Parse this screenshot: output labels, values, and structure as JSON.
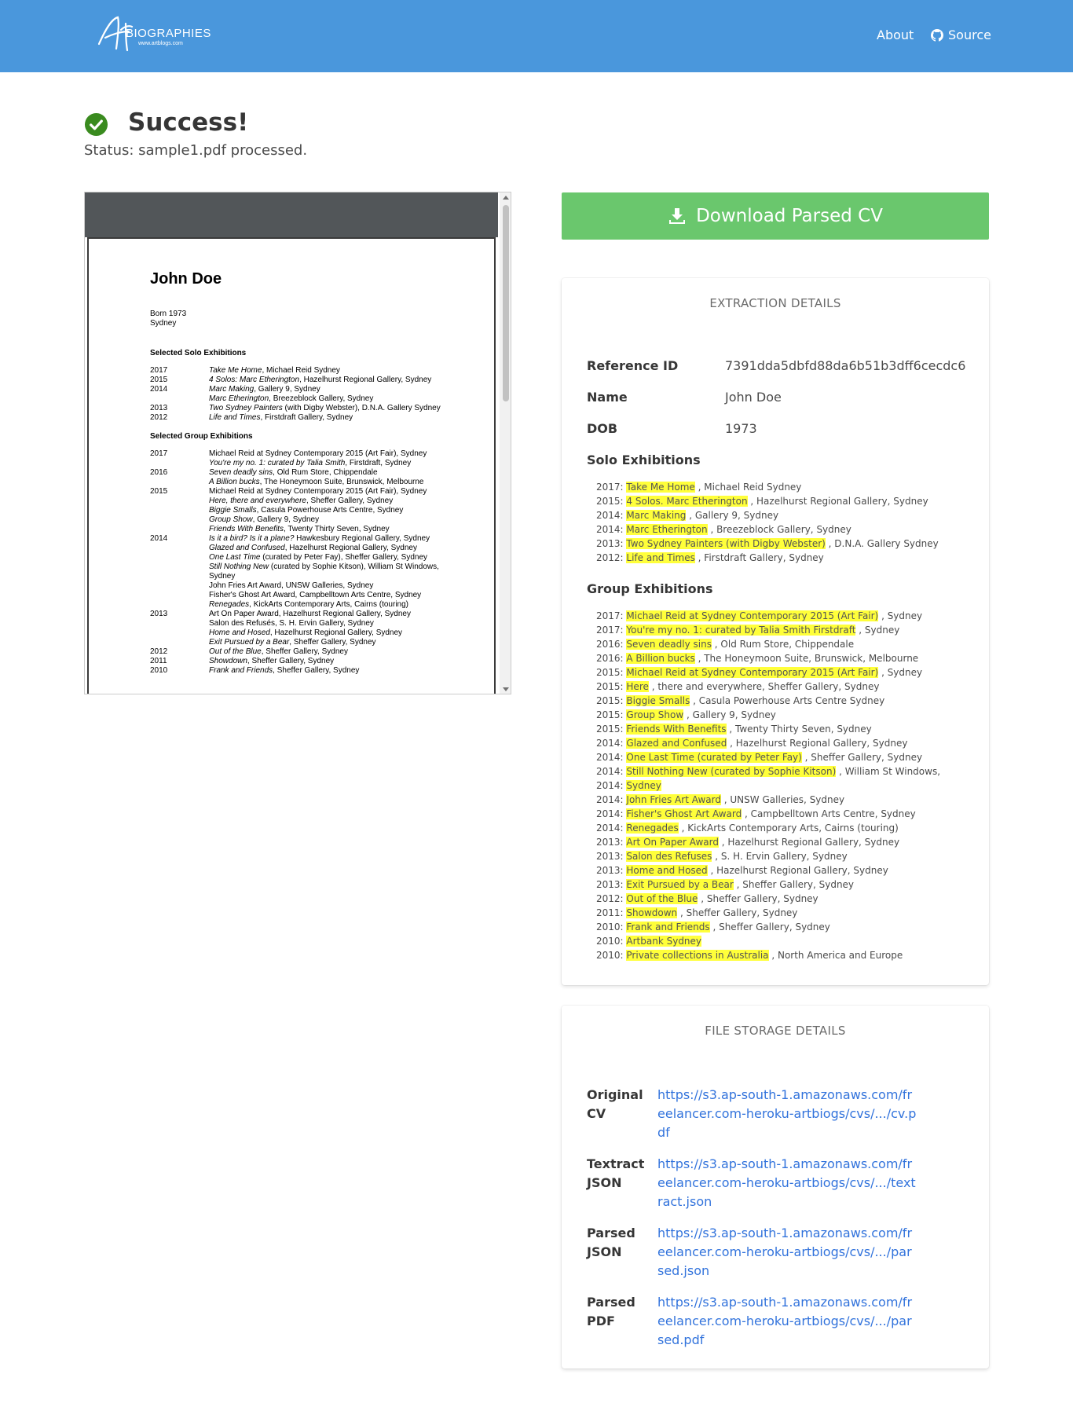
{
  "nav": {
    "logo_text": "BIOGRAPHIES",
    "logo_url": "www.artblogs.com",
    "about": "About",
    "source": "Source",
    "colors": {
      "navbar": "#4a97dc"
    }
  },
  "status": {
    "title": "Success!",
    "message": "Status: sample1.pdf processed.",
    "icon": "check-circle-icon",
    "color": "#3a8b1f"
  },
  "pdf": {
    "name": "John Doe",
    "born": [
      "Born 1973",
      "Sydney"
    ],
    "solo_heading": "Selected Solo Exhibitions",
    "solo": [
      {
        "year": "2017",
        "title": "Take Me Home",
        "rest": ", Michael Reid Sydney"
      },
      {
        "year": "2015",
        "title": "4 Solos: Marc Etherington",
        "rest": ", Hazelhurst Regional Gallery, Sydney"
      },
      {
        "year": "2014",
        "title": "Marc Making",
        "rest": ", Gallery 9, Sydney"
      },
      {
        "year": "",
        "title": "Marc Etherington",
        "rest": ", Breezeblock Gallery, Sydney"
      },
      {
        "year": "2013",
        "title": "Two Sydney Painters",
        "rest": " (with Digby Webster), D.N.A. Gallery Sydney"
      },
      {
        "year": "2012",
        "title": "Life and Times",
        "rest": ", Firstdraft Gallery, Sydney"
      }
    ],
    "group_heading": "Selected Group Exhibitions",
    "group": [
      {
        "year": "2017",
        "title": "",
        "rest": "Michael Reid at Sydney Contemporary 2015 (Art Fair), Sydney"
      },
      {
        "year": "",
        "title": "You're my no. 1: curated by Talia Smith",
        "rest": ", Firstdraft, Sydney"
      },
      {
        "year": "2016",
        "title": "Seven deadly sins",
        "rest": ", Old Rum Store, Chippendale"
      },
      {
        "year": "",
        "title": "A Billion bucks",
        "rest": ", The Honeymoon Suite, Brunswick, Melbourne"
      },
      {
        "year": "2015",
        "title": "",
        "rest": "Michael Reid at Sydney Contemporary 2015 (Art Fair), Sydney"
      },
      {
        "year": "",
        "title": "Here, there and everywhere",
        "rest": ", Sheffer Gallery, Sydney"
      },
      {
        "year": "",
        "title": "Biggie Smalls",
        "rest": ", Casula Powerhouse Arts Centre, Sydney"
      },
      {
        "year": "",
        "title": "Group Show",
        "rest": ", Gallery 9, Sydney"
      },
      {
        "year": "",
        "title": "Friends With Benefits",
        "rest": ", Twenty Thirty Seven, Sydney"
      },
      {
        "year": "2014",
        "title": "Is it a bird? Is it a plane?",
        "rest": " Hawkesbury Regional Gallery, Sydney"
      },
      {
        "year": "",
        "title": "Glazed and Confused",
        "rest": ", Hazelhurst Regional Gallery, Sydney"
      },
      {
        "year": "",
        "title": "One Last Time",
        "rest": " (curated by Peter Fay), Sheffer Gallery, Sydney"
      },
      {
        "year": "",
        "title": "Still Nothing New",
        "rest": " (curated by Sophie Kitson), William St Windows,"
      },
      {
        "year": "",
        "title": "",
        "rest": "Sydney"
      },
      {
        "year": "",
        "title": "",
        "rest": "John Fries Art Award, UNSW Galleries, Sydney"
      },
      {
        "year": "",
        "title": "",
        "rest": "Fisher's Ghost Art Award, Campbelltown Arts Centre, Sydney"
      },
      {
        "year": "",
        "title": "Renegades",
        "rest": ", KickArts Contemporary Arts, Cairns (touring)"
      },
      {
        "year": "2013",
        "title": "",
        "rest": "Art On Paper Award, Hazelhurst Regional Gallery, Sydney"
      },
      {
        "year": "",
        "title": "",
        "rest": "Salon des Refusés, S. H. Ervin Gallery, Sydney"
      },
      {
        "year": "",
        "title": "Home and Hosed",
        "rest": ", Hazelhurst Regional Gallery, Sydney"
      },
      {
        "year": "",
        "title": "Exit Pursued by a Bear",
        "rest": ", Sheffer Gallery, Sydney"
      },
      {
        "year": "2012",
        "title": "Out of the Blue",
        "rest": ", Sheffer Gallery, Sydney"
      },
      {
        "year": "2011",
        "title": "Showdown",
        "rest": ", Sheffer Gallery, Sydney"
      },
      {
        "year": "2010",
        "title": "Frank and Friends",
        "rest": ", Sheffer Gallery, Sydney"
      }
    ]
  },
  "download": {
    "label": "Download Parsed CV",
    "color": "#6ac76d"
  },
  "extraction": {
    "header": "EXTRACTION DETAILS",
    "reference_label": "Reference ID",
    "reference_value": "7391dda5dbfd88da6b51b3dff6cecdc6",
    "name_label": "Name",
    "name_value": "John Doe",
    "dob_label": "DOB",
    "dob_value": "1973",
    "solo_title": "Solo Exhibitions",
    "solo": [
      {
        "year": "2017:",
        "hl": "Take Me Home",
        "rest": " , Michael Reid Sydney"
      },
      {
        "year": "2015:",
        "hl": "4 Solos. Marc Etherington",
        "rest": " , Hazelhurst Regional Gallery, Sydney"
      },
      {
        "year": "2014:",
        "hl": "Marc Making",
        "rest": " , Gallery 9, Sydney"
      },
      {
        "year": "2014:",
        "hl": "Marc Etherington",
        "rest": " , Breezeblock Gallery, Sydney"
      },
      {
        "year": "2013:",
        "hl": "Two Sydney Painters (with Digby Webster)",
        "rest": " , D.N.A. Gallery Sydney"
      },
      {
        "year": "2012:",
        "hl": "Life and Times",
        "rest": " , Firstdraft Gallery, Sydney"
      }
    ],
    "group_title": "Group Exhibitions",
    "group": [
      {
        "year": "2017:",
        "hl": "Michael Reid at Sydney Contemporary 2015 (Art Fair)",
        "rest": " , Sydney"
      },
      {
        "year": "2017:",
        "hl": "You're my no. 1: curated by Talia Smith Firstdraft",
        "rest": " , Sydney"
      },
      {
        "year": "2016:",
        "hl": "Seven deadly sins",
        "rest": " , Old Rum Store, Chippendale"
      },
      {
        "year": "2016:",
        "hl": "A Billion bucks",
        "rest": " , The Honeymoon Suite, Brunswick, Melbourne"
      },
      {
        "year": "2015:",
        "hl": "Michael Reid at Sydney Contemporary 2015 (Art Fair)",
        "rest": " , Sydney"
      },
      {
        "year": "2015:",
        "hl": "Here",
        "rest": " , there and everywhere, Sheffer Gallery, Sydney"
      },
      {
        "year": "2015:",
        "hl": "Biggie Smalls",
        "rest": " , Casula Powerhouse Arts Centre Sydney"
      },
      {
        "year": "2015:",
        "hl": "Group Show",
        "rest": " , Gallery 9, Sydney"
      },
      {
        "year": "2015:",
        "hl": "Friends With Benefits",
        "rest": " , Twenty Thirty Seven, Sydney"
      },
      {
        "year": "2014:",
        "hl": "Glazed and Confused",
        "rest": " , Hazelhurst Regional Gallery, Sydney"
      },
      {
        "year": "2014:",
        "hl": "One Last Time (curated by Peter Fay)",
        "rest": " , Sheffer Gallery, Sydney"
      },
      {
        "year": "2014:",
        "hl": "Still Nothing New (curated by Sophie Kitson)",
        "rest": " , William St Windows,"
      },
      {
        "year": "2014:",
        "hl": "Sydney",
        "rest": ""
      },
      {
        "year": "2014:",
        "hl": "John Fries Art Award",
        "rest": " , UNSW Galleries, Sydney"
      },
      {
        "year": "2014:",
        "hl": "Fisher's Ghost Art Award",
        "rest": " , Campbelltown Arts Centre, Sydney"
      },
      {
        "year": "2014:",
        "hl": "Renegades",
        "rest": " , KickArts Contemporary Arts, Cairns (touring)"
      },
      {
        "year": "2013:",
        "hl": "Art On Paper Award",
        "rest": " , Hazelhurst Regional Gallery, Sydney"
      },
      {
        "year": "2013:",
        "hl": "Salon des Refuses",
        "rest": " , S. H. Ervin Gallery, Sydney"
      },
      {
        "year": "2013:",
        "hl": "Home and Hosed",
        "rest": " , Hazelhurst Regional Gallery, Sydney"
      },
      {
        "year": "2013:",
        "hl": "Exit Pursued by a Bear",
        "rest": " , Sheffer Gallery, Sydney"
      },
      {
        "year": "2012:",
        "hl": "Out of the Blue",
        "rest": " , Sheffer Gallery, Sydney"
      },
      {
        "year": "2011:",
        "hl": "Showdown",
        "rest": " , Sheffer Gallery, Sydney"
      },
      {
        "year": "2010:",
        "hl": "Frank and Friends",
        "rest": " , Sheffer Gallery, Sydney"
      },
      {
        "year": "2010:",
        "hl": "Artbank Sydney",
        "rest": ""
      },
      {
        "year": "2010:",
        "hl": "Private collections in Australia",
        "rest": " , North America and Europe"
      }
    ]
  },
  "storage": {
    "header": "FILE STORAGE DETAILS",
    "items": [
      {
        "label": "Original CV",
        "link": "https://s3.ap-south-1.amazonaws.com/freelancer.com-heroku-artbiogs/cvs/.../cv.pdf"
      },
      {
        "label": "Textract JSON",
        "link": "https://s3.ap-south-1.amazonaws.com/freelancer.com-heroku-artbiogs/cvs/.../textract.json"
      },
      {
        "label": "Parsed JSON",
        "link": "https://s3.ap-south-1.amazonaws.com/freelancer.com-heroku-artbiogs/cvs/.../parsed.json"
      },
      {
        "label": "Parsed PDF",
        "link": "https://s3.ap-south-1.amazonaws.com/freelancer.com-heroku-artbiogs/cvs/.../parsed.pdf"
      }
    ]
  }
}
